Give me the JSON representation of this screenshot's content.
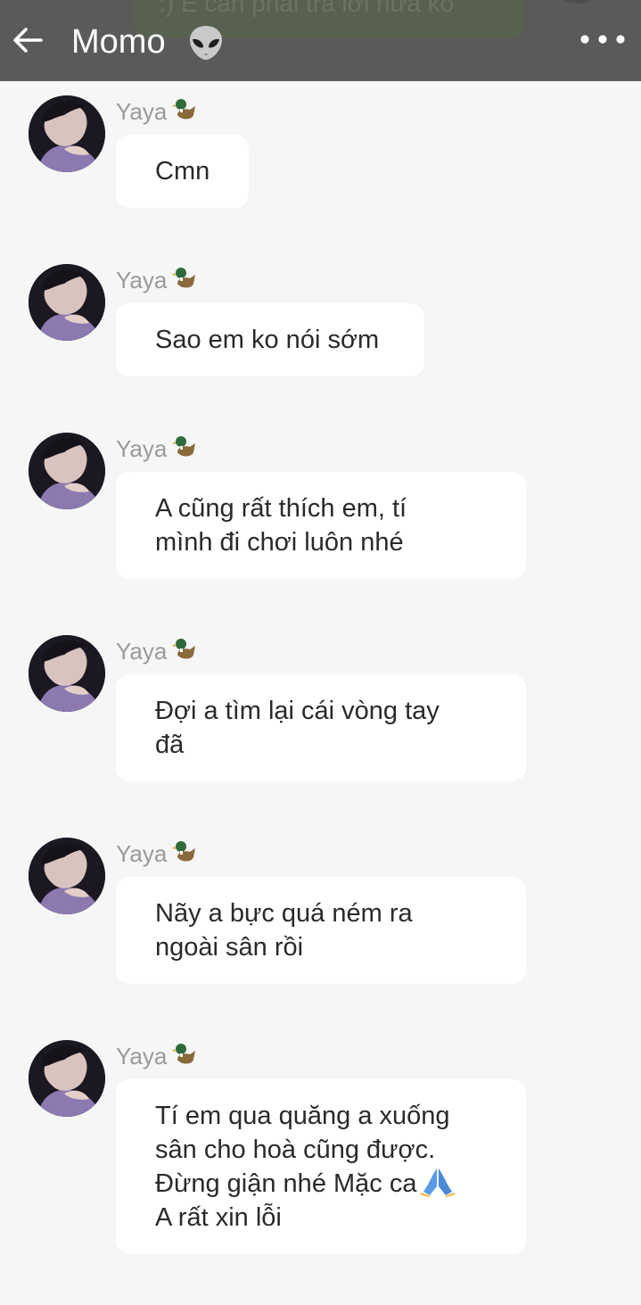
{
  "header": {
    "peek_text": ":) E cần phải trả lời nữa ko",
    "title": "Momo",
    "title_emoji": "alien-icon",
    "back": "back-arrow-icon",
    "more": "more-dots-icon",
    "background": "#5a5a5a"
  },
  "messages": [
    {
      "sender": "Yaya",
      "emoji": "duck-icon",
      "lines": [
        "Cmn"
      ]
    },
    {
      "sender": "Yaya",
      "emoji": "duck-icon",
      "lines": [
        "Sao em ko nói sớm"
      ]
    },
    {
      "sender": "Yaya",
      "emoji": "duck-icon",
      "lines": [
        "A cũng rất thích em, tí",
        "mình đi chơi luôn nhé"
      ]
    },
    {
      "sender": "Yaya",
      "emoji": "duck-icon",
      "lines": [
        "Đợi a tìm lại cái vòng tay",
        "đã"
      ]
    },
    {
      "sender": "Yaya",
      "emoji": "duck-icon",
      "lines": [
        "Nãy a bực quá ném ra",
        "ngoài sân rồi"
      ]
    },
    {
      "sender": "Yaya",
      "emoji": "duck-icon",
      "lines": [
        "Tí em qua quăng a xuống",
        "sân cho hoà cũng được.",
        "Đừng giận nhé Mặc ca",
        "A rất xin lỗi"
      ],
      "trailing_emoji": "folded-hands-icon"
    }
  ],
  "colors": {
    "background": "#f6f6f6",
    "bubble": "#ffffff",
    "sender": "#9a9a9a",
    "text": "#2a2a2a"
  }
}
